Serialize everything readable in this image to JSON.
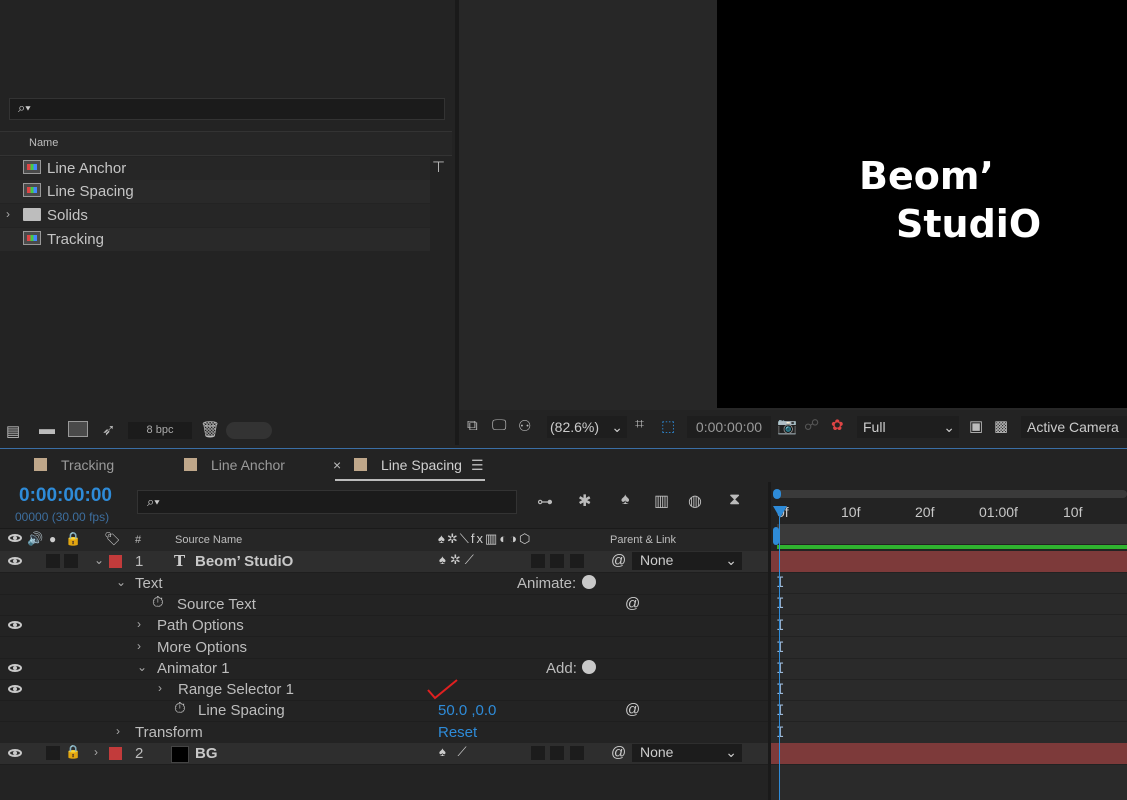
{
  "project": {
    "search_placeholder": "",
    "column_name": "Name",
    "items": [
      {
        "label": "Line Anchor",
        "icon": "composition-icon"
      },
      {
        "label": "Line Spacing",
        "icon": "composition-icon"
      },
      {
        "label": "Solids",
        "icon": "folder-icon"
      },
      {
        "label": "Tracking",
        "icon": "composition-icon"
      }
    ],
    "bpc": "8 bpc"
  },
  "viewer": {
    "text_line1": "Beom’",
    "text_line2": "StudiO",
    "zoom": "(82.6%)",
    "timecode": "0:00:00:00",
    "resolution": "Full",
    "camera": "Active Camera"
  },
  "timeline": {
    "tabs": [
      {
        "label": "Tracking"
      },
      {
        "label": "Line Anchor"
      },
      {
        "label": "Line Spacing"
      }
    ],
    "close_glyph": "×",
    "menu_glyph": "☰",
    "timecode": "0:00:00:00",
    "fps": "00000 (30.00 fps)",
    "col_hash": "#",
    "col_source": "Source Name",
    "col_parent": "Parent & Link",
    "ruler_ticks": [
      "0f",
      "10f",
      "20f",
      "01:00f",
      "10f"
    ],
    "layers": [
      {
        "num": "1",
        "name": "Beom’ StudiO",
        "parent": "None"
      },
      {
        "num": "2",
        "name": "BG",
        "parent": "None"
      }
    ],
    "props": {
      "text": "Text",
      "animate": "Animate:",
      "source_text": "Source Text",
      "path_options": "Path Options",
      "more_options": "More Options",
      "animator": "Animator 1",
      "add": "Add:",
      "range_selector": "Range Selector 1",
      "line_spacing": "Line Spacing",
      "line_spacing_value": "50.0 ,0.0",
      "transform": "Transform",
      "reset": "Reset"
    },
    "colors": {
      "accent": "#2e8bd8",
      "label_red": "#c23b3b",
      "track_red": "#7d3a3a",
      "green_bar": "#2fb32f"
    }
  }
}
